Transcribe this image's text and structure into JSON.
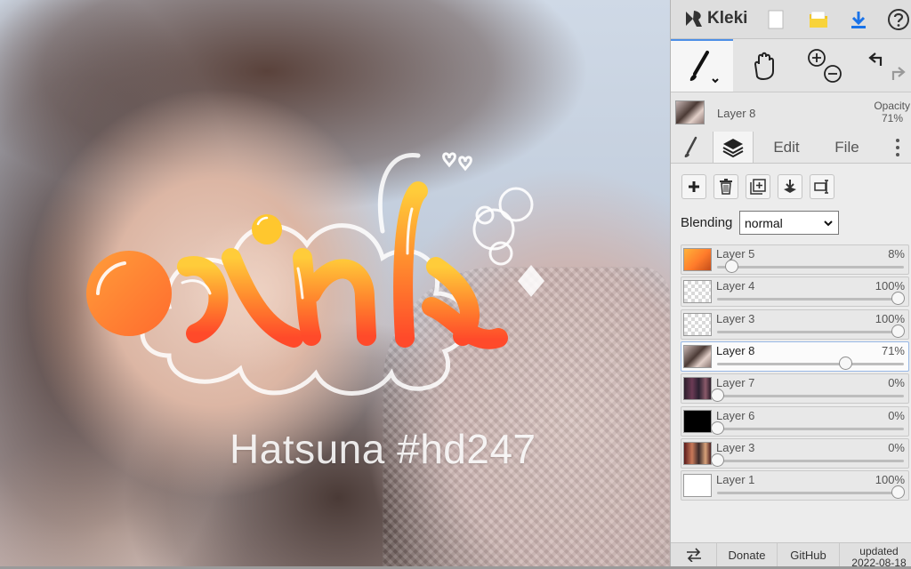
{
  "app": {
    "name": "Kleki"
  },
  "canvas": {
    "caption": "Hatsuna #hd247"
  },
  "active_layer": {
    "name": "Layer 8",
    "opacity_label": "Opacity",
    "opacity_value": "71%"
  },
  "tabs": [
    {
      "label": ""
    },
    {
      "label": ""
    },
    {
      "label": "Edit"
    },
    {
      "label": "File"
    }
  ],
  "layer_actions": [
    "add-layer",
    "delete-layer",
    "duplicate-layer",
    "merge-down",
    "rename-layer"
  ],
  "blending": {
    "label": "Blending",
    "value": "normal"
  },
  "layers": [
    {
      "name": "Layer 5",
      "opacity": "8%",
      "level": 0.08,
      "thumb": "orange",
      "selected": false
    },
    {
      "name": "Layer 4",
      "opacity": "100%",
      "level": 1.0,
      "thumb": "check",
      "selected": false
    },
    {
      "name": "Layer 3",
      "opacity": "100%",
      "level": 1.0,
      "thumb": "check",
      "selected": false
    },
    {
      "name": "Layer 8",
      "opacity": "71%",
      "level": 0.71,
      "thumb": "photo",
      "selected": true
    },
    {
      "name": "Layer 7",
      "opacity": "0%",
      "level": 0.0,
      "thumb": "dark",
      "selected": false
    },
    {
      "name": "Layer 6",
      "opacity": "0%",
      "level": 0.0,
      "thumb": "black",
      "selected": false
    },
    {
      "name": "Layer 3",
      "opacity": "0%",
      "level": 0.0,
      "thumb": "warm",
      "selected": false
    },
    {
      "name": "Layer 1",
      "opacity": "100%",
      "level": 1.0,
      "thumb": "white",
      "selected": false
    }
  ],
  "footer": {
    "donate": "Donate",
    "github": "GitHub",
    "updated": "updated",
    "date": "2022-08-18"
  },
  "colors": {
    "accent": "#4d8fe6",
    "download": "#1a73e8",
    "folder": "#f5c518"
  }
}
